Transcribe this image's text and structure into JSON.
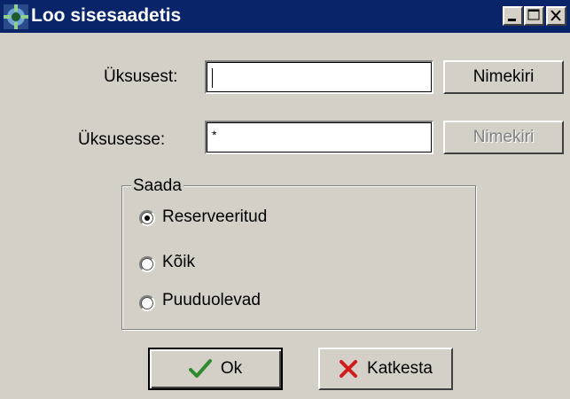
{
  "window": {
    "title": "Loo sisesaadetis",
    "accent": "#0a246a",
    "background": "#d4d0c8"
  },
  "form": {
    "from_label": "Üksusest:",
    "from_value": "",
    "from_list_button": "Nimekiri",
    "to_label": "Üksusesse:",
    "to_value": "*",
    "to_list_button": "Nimekiri",
    "to_list_button_disabled": true
  },
  "send_group": {
    "legend": "Saada",
    "options": [
      {
        "label": "Reserveeritud",
        "selected": true
      },
      {
        "label": "Kõik",
        "selected": false
      },
      {
        "label": "Puuduolevad",
        "selected": false
      }
    ]
  },
  "buttons": {
    "ok_label": "Ok",
    "ok_icon": "checkmark-icon",
    "cancel_label": "Katkesta",
    "cancel_icon": "x-icon"
  }
}
